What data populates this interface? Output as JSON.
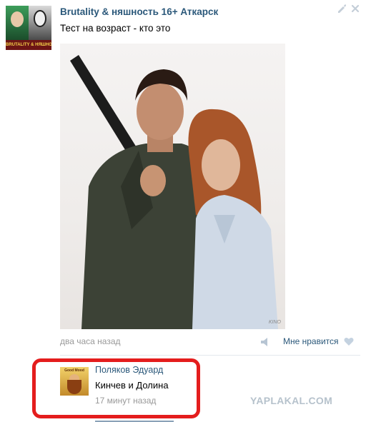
{
  "post": {
    "group_name": "Brutality & няшность 16+ Аткарск",
    "text": "Тест на возраст - кто это",
    "avatar_strip_text": "BRUTALITY & НЯШНОСТЬ",
    "photo_watermark": "KINO",
    "time": "два часа назад",
    "like_label": "Мне нравится"
  },
  "comment": {
    "author": "Поляков Эдуард",
    "text": "Кинчев и Долина",
    "time": "17 минут назад",
    "avatar_text": "Good Mood"
  },
  "site_watermark": "YAPLAKAL.COM",
  "colors": {
    "link": "#2b587a",
    "muted": "#999999",
    "highlight": "#e41d1d",
    "watermark": "#b6c2cc"
  },
  "icons": [
    "edit-icon",
    "close-icon",
    "share-icon",
    "heart-icon"
  ]
}
